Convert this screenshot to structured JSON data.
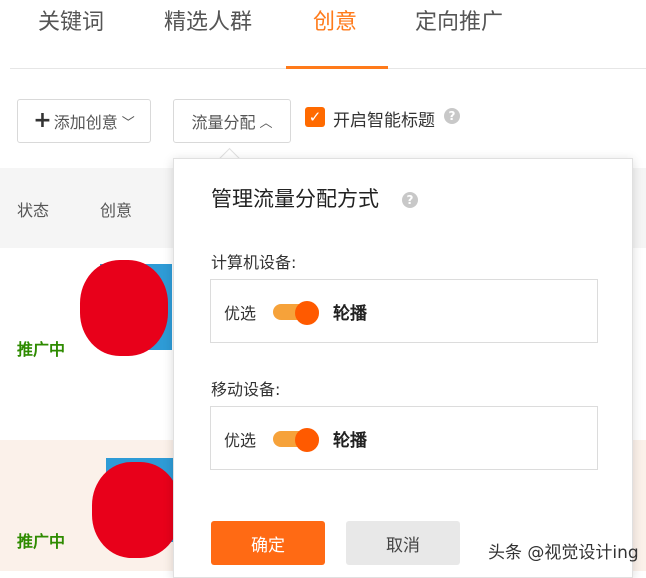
{
  "tabs": [
    {
      "label": "关键词"
    },
    {
      "label": "精选人群"
    },
    {
      "label": "创意",
      "active": true
    },
    {
      "label": "定向推广"
    }
  ],
  "toolbar": {
    "add_creative_label": "添加创意",
    "traffic_label": "流量分配",
    "smart_title_label": "开启智能标题",
    "smart_title_checked": true
  },
  "table": {
    "headers": [
      "状态",
      "创意"
    ],
    "rows": [
      {
        "status": "推广中"
      },
      {
        "status": "推广中"
      }
    ]
  },
  "popup": {
    "title": "管理流量分配方式",
    "sections": [
      {
        "label": "计算机设备:",
        "left_option": "优选",
        "right_option": "轮播",
        "selected": "轮播"
      },
      {
        "label": "移动设备:",
        "left_option": "优选",
        "right_option": "轮播",
        "selected": "轮播"
      }
    ],
    "confirm_label": "确定",
    "cancel_label": "取消"
  },
  "watermark": "头条 @视觉设计ing",
  "colors": {
    "accent": "#ff7a1a",
    "status_active": "#2e8b00",
    "toggle_on": "#ff5a00"
  }
}
